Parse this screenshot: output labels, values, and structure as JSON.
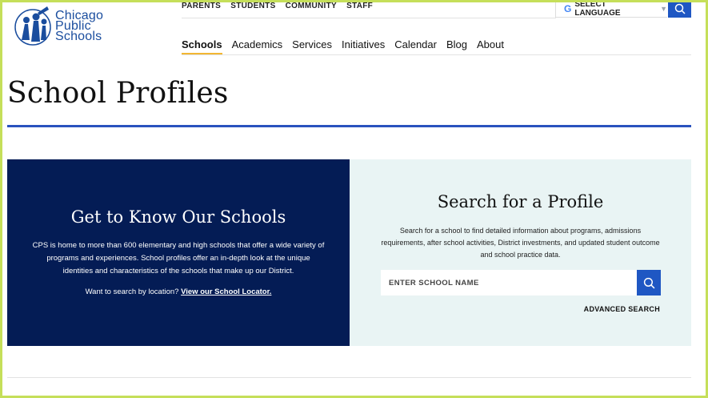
{
  "logo": {
    "line1": "Chicago",
    "line2": "Public",
    "line3": "Schools"
  },
  "utility_nav": [
    "PARENTS",
    "STUDENTS",
    "COMMUNITY",
    "STAFF"
  ],
  "language": {
    "label": "SELECT LANGUAGE",
    "g": "G",
    "caret": "▼"
  },
  "main_nav": [
    "Schools",
    "Academics",
    "Services",
    "Initiatives",
    "Calendar",
    "Blog",
    "About"
  ],
  "page_title": "School Profiles",
  "left_panel": {
    "heading": "Get to Know Our Schools",
    "description": "CPS is home to more than 600 elementary and high schools that offer a wide variety of programs and experiences. School profiles offer an in-depth look at the unique identities and characteristics of the schools that make up our District.",
    "locator_prefix": "Want to search by location?",
    "locator_link": "View our School Locator."
  },
  "right_panel": {
    "heading": "Search for a Profile",
    "description": "Search for a school to find detailed information about programs, admissions requirements, after school activities, District investments, and updated student outcome and school practice data.",
    "search_placeholder": "ENTER SCHOOL NAME",
    "advanced": "ADVANCED SEARCH"
  },
  "colors": {
    "brand_blue": "#1f57c3",
    "navy": "#041c55",
    "light_panel": "#e9f4f4",
    "accent": "#f2b632"
  }
}
